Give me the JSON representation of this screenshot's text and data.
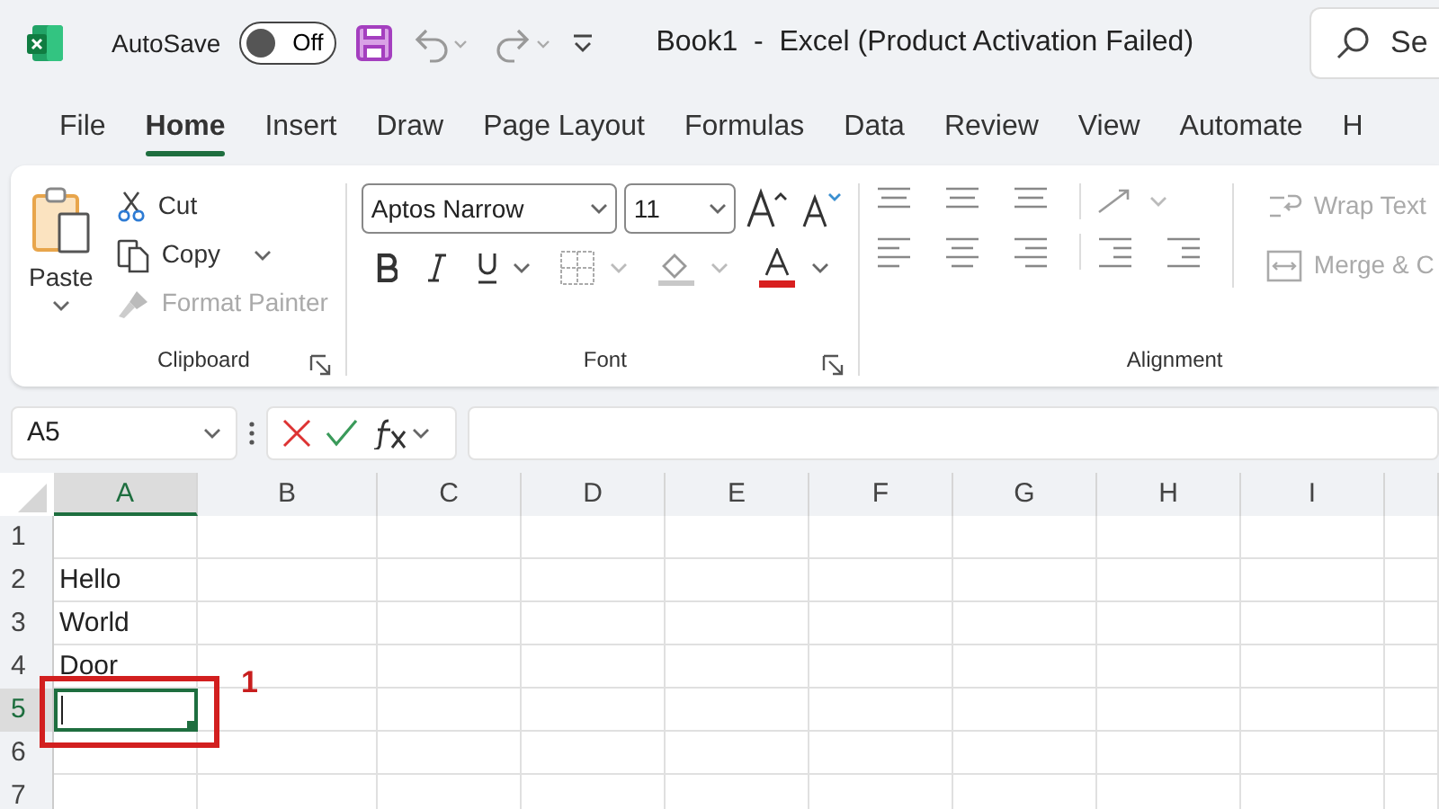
{
  "title_bar": {
    "autosave_label": "AutoSave",
    "autosave_toggle": {
      "label": "Off",
      "on": false
    },
    "document_title": "Book1  -  Excel (Product Activation Failed)",
    "search": {
      "placeholder": "Se"
    }
  },
  "tabs": [
    {
      "label": "File",
      "selected": false
    },
    {
      "label": "Home",
      "selected": true
    },
    {
      "label": "Insert",
      "selected": false
    },
    {
      "label": "Draw",
      "selected": false
    },
    {
      "label": "Page Layout",
      "selected": false
    },
    {
      "label": "Formulas",
      "selected": false
    },
    {
      "label": "Data",
      "selected": false
    },
    {
      "label": "Review",
      "selected": false
    },
    {
      "label": "View",
      "selected": false
    },
    {
      "label": "Automate",
      "selected": false
    },
    {
      "label": "H",
      "selected": false
    }
  ],
  "ribbon": {
    "clipboard": {
      "title": "Clipboard",
      "paste": "Paste",
      "cut": {
        "label": "Cut",
        "disabled": false
      },
      "copy": {
        "label": "Copy",
        "disabled": false
      },
      "format_painter": {
        "label": "Format Painter",
        "disabled": true
      }
    },
    "font": {
      "title": "Font",
      "font_name": "Aptos Narrow",
      "font_size": "11"
    },
    "alignment": {
      "title": "Alignment",
      "wrap_text": {
        "label": "Wrap Text",
        "disabled": true
      },
      "merge": {
        "label": "Merge & C",
        "disabled": true
      }
    }
  },
  "formula_bar": {
    "name_box": "A5"
  },
  "sheet": {
    "columns": [
      {
        "label": "A",
        "selected": true
      },
      {
        "label": "B",
        "selected": false
      },
      {
        "label": "C",
        "selected": false
      },
      {
        "label": "D",
        "selected": false
      },
      {
        "label": "E",
        "selected": false
      },
      {
        "label": "F",
        "selected": false
      },
      {
        "label": "G",
        "selected": false
      },
      {
        "label": "H",
        "selected": false
      },
      {
        "label": "I",
        "selected": false
      }
    ],
    "rows": [
      {
        "label": "1",
        "selected": false
      },
      {
        "label": "2",
        "value": "Hello",
        "selected": false
      },
      {
        "label": "3",
        "value": "World",
        "selected": false
      },
      {
        "label": "4",
        "value": "Door",
        "selected": false
      },
      {
        "label": "5",
        "selected": true
      },
      {
        "label": "6",
        "selected": false
      },
      {
        "label": "7",
        "selected": false
      }
    ]
  },
  "annotation": {
    "label": "1"
  }
}
